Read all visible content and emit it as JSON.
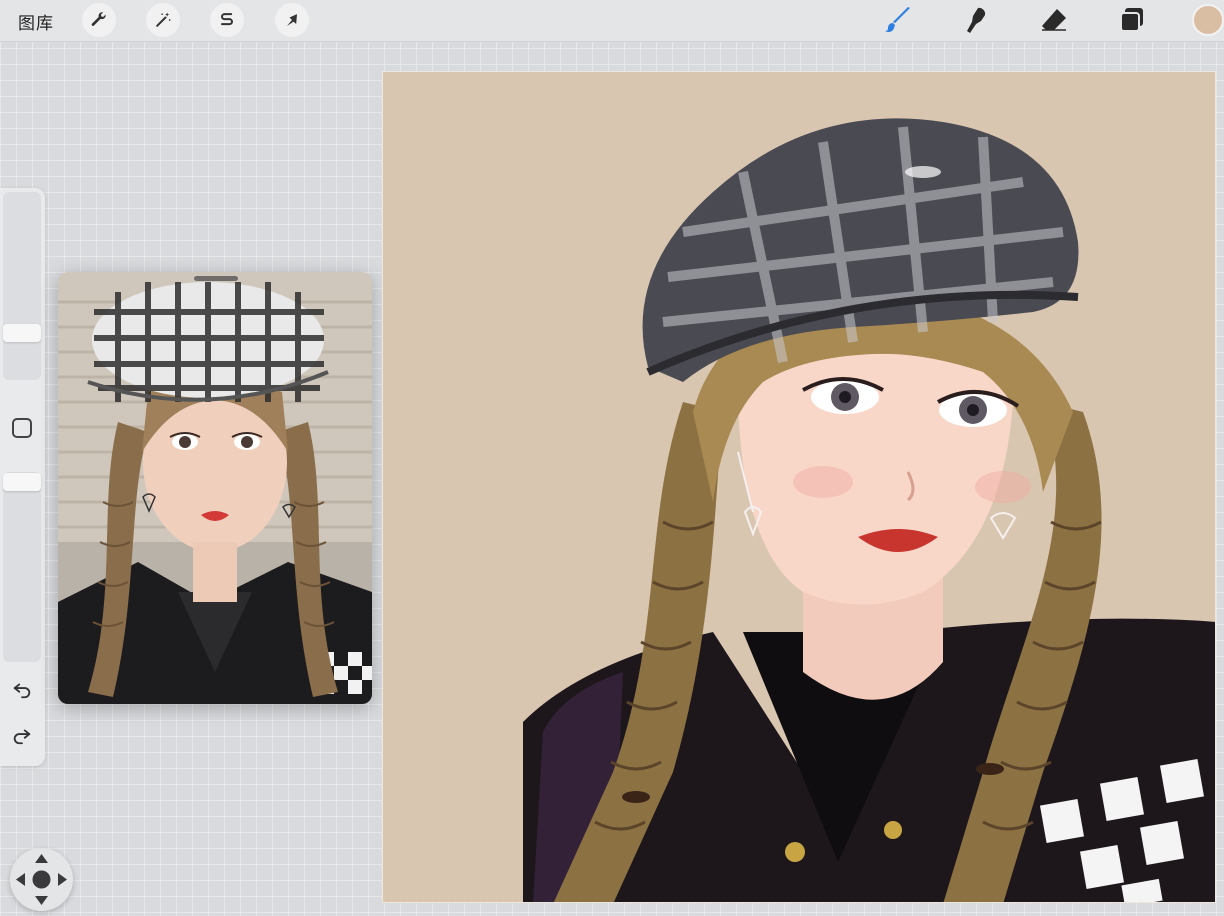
{
  "topbar": {
    "gallery_label": "图库",
    "left_tools": [
      "wrench-icon",
      "magic-wand-icon",
      "selection-s-icon",
      "transform-arrow-icon"
    ],
    "right_tools": [
      "brush-icon",
      "smudge-icon",
      "eraser-icon",
      "layers-icon"
    ],
    "brush_active_color": "#2f7fe0",
    "current_color": "#d9bea3"
  },
  "sidebar": {
    "brush_size_level": 0.78,
    "opacity_level": 0.0
  },
  "colors": {
    "canvas_background": "#d9c6b1",
    "workspace_background": "#d8dadd"
  }
}
